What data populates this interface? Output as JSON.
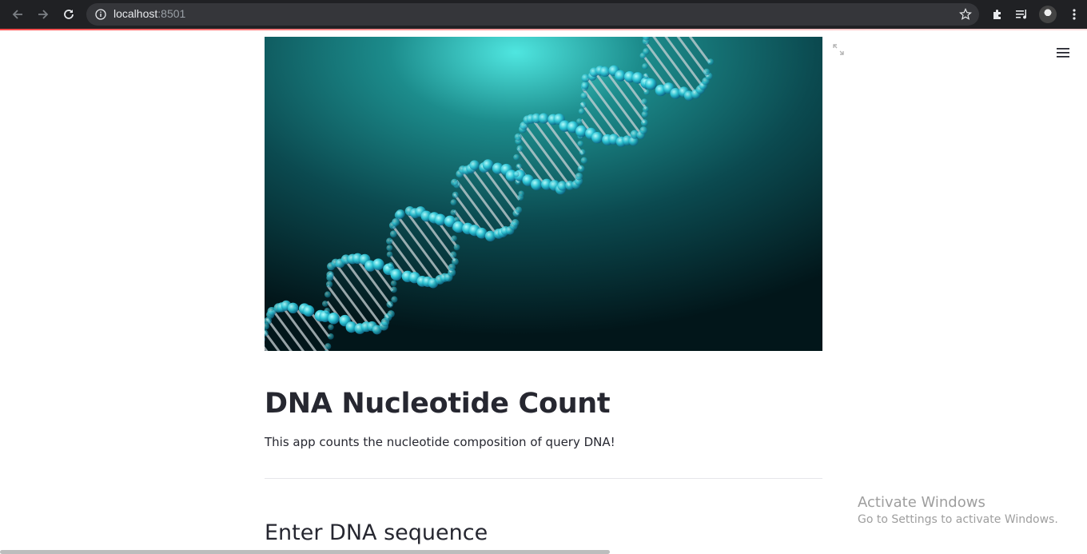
{
  "browser": {
    "url_host": "localhost",
    "url_port": ":8501",
    "icons": [
      "back-arrow-icon",
      "forward-arrow-icon",
      "reload-icon",
      "info-icon",
      "star-icon",
      "extensions-icon",
      "media-control-icon",
      "profile-avatar",
      "more-vert-icon"
    ],
    "accent_color": "#ff4b4b"
  },
  "app": {
    "hero_image": "dna-double-helix",
    "title": "DNA Nucleotide Count",
    "description": "This app counts the nucleotide composition of query DNA!",
    "subheader": "Enter DNA sequence",
    "text_color": "#262730"
  },
  "windows_watermark": {
    "line1": "Activate Windows",
    "line2": "Go to Settings to activate Windows."
  }
}
